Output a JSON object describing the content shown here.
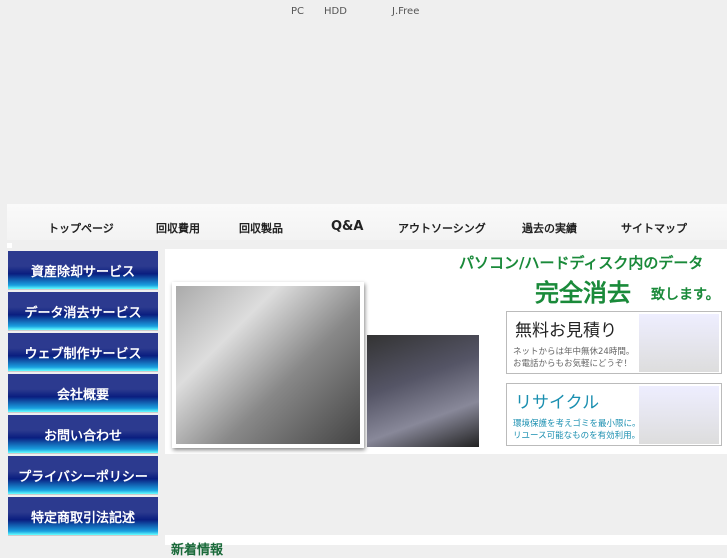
{
  "header": {
    "pc": "PC",
    "hdd": "HDD",
    "brand": "J.Free"
  },
  "nav": [
    "トップページ",
    "回収費用",
    "回収製品",
    "Q&A",
    "アウトソーシング",
    "過去の実績",
    "サイトマップ"
  ],
  "sidebar": [
    "資産除却サービス",
    "データ消去サービス",
    "ウェブ制作サービス",
    "会社概要",
    "お問い合わせ",
    "プライバシーポリシー",
    "特定商取引法記述"
  ],
  "hero": {
    "line1": "パソコン/ハードディスク内のデータ",
    "line2": "完全消去",
    "line3": "致します。"
  },
  "cards": [
    {
      "title": "無料お見積り",
      "text1": "ネットからは年中無休24時間。",
      "text2": "お電話からもお気軽にどうぞ！"
    },
    {
      "title": "リサイクル",
      "text1": "環境保護を考えゴミを最小限に。",
      "text2": "リユース可能なものを有効利用。"
    }
  ],
  "news": {
    "title": "新着情報"
  }
}
